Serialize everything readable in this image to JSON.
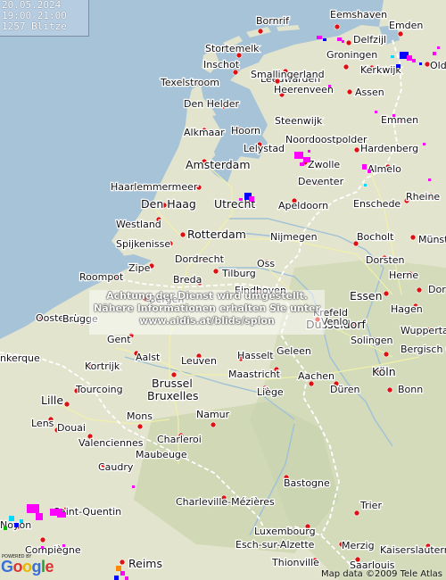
{
  "info": {
    "date": "20.05.2024",
    "time_range": "19:00-21:00",
    "strike_count": "1257 Blitze"
  },
  "notice": {
    "line1": "Achtung der Dienst wird umgestellt.",
    "line2": "Nähere Informationen erhalten Sie unter",
    "line3": "www.aldis.at/blids/splon"
  },
  "attribution": "Map data ©2009 Tele Atlas",
  "logo": {
    "powered": "POWERED BY",
    "g1": "G",
    "g2": "o",
    "g3": "o",
    "g4": "g",
    "g5": "l",
    "g6": "e"
  },
  "colors": {
    "sea": "#a7c3d8",
    "land": "#e6e2cf",
    "border": "#ffffff",
    "city": "#dd1111",
    "strike_recent": "#ff00ff",
    "strike_older": "#0000ff"
  },
  "cities": [
    {
      "name": "Bornrif"
    },
    {
      "name": "Eemshaven"
    },
    {
      "name": "Emden"
    },
    {
      "name": "Delfzijl"
    },
    {
      "name": "Stortemelk"
    },
    {
      "name": "Leeuwarden"
    },
    {
      "name": "Groningen"
    },
    {
      "name": "Kerkwijk"
    },
    {
      "name": "Olde"
    },
    {
      "name": "Inschot"
    },
    {
      "name": "Smallingerland"
    },
    {
      "name": "Texelstroom"
    },
    {
      "name": "Heerenveen"
    },
    {
      "name": "Assen"
    },
    {
      "name": "Den Helder"
    },
    {
      "name": "Steenwijk"
    },
    {
      "name": "Emmen"
    },
    {
      "name": "Alkmaar"
    },
    {
      "name": "Hoorn"
    },
    {
      "name": "Noordoostpolder"
    },
    {
      "name": "Lelystad"
    },
    {
      "name": "Hardenberg"
    },
    {
      "name": "Amsterdam"
    },
    {
      "name": "Zwolle"
    },
    {
      "name": "Almelo"
    },
    {
      "name": "Haarlemmermeer"
    },
    {
      "name": "Deventer"
    },
    {
      "name": "Den Haag"
    },
    {
      "name": "Utrecht"
    },
    {
      "name": "Apeldoorn"
    },
    {
      "name": "Enschede"
    },
    {
      "name": "Rheine"
    },
    {
      "name": "Westland"
    },
    {
      "name": "Rotterdam"
    },
    {
      "name": "Nijmegen"
    },
    {
      "name": "Bocholt"
    },
    {
      "name": "Münst"
    },
    {
      "name": "Spijkenisse"
    },
    {
      "name": "Dordrecht"
    },
    {
      "name": "Dorsten"
    },
    {
      "name": "Roompot"
    },
    {
      "name": "Zipe"
    },
    {
      "name": "Tilburg"
    },
    {
      "name": "Oss"
    },
    {
      "name": "Herne"
    },
    {
      "name": "Breda"
    },
    {
      "name": "Bergen"
    },
    {
      "name": "Eindhoven"
    },
    {
      "name": "Essen"
    },
    {
      "name": "Dor"
    },
    {
      "name": "Krefeld"
    },
    {
      "name": "Hagen"
    },
    {
      "name": "Oostende"
    },
    {
      "name": "Brugge"
    },
    {
      "name": "Gent"
    },
    {
      "name": "Düsseldorf"
    },
    {
      "name": "Wupperta"
    },
    {
      "name": "Venlo"
    },
    {
      "name": "Solingen"
    },
    {
      "name": "Bergisch Gladbach"
    },
    {
      "name": "nkerque"
    },
    {
      "name": "Aalst"
    },
    {
      "name": "Leuven"
    },
    {
      "name": "Hasselt"
    },
    {
      "name": "Geleen"
    },
    {
      "name": "Kortrijk"
    },
    {
      "name": "Köln"
    },
    {
      "name": "Lille"
    },
    {
      "name": "Tourcoing"
    },
    {
      "name": "Brussel"
    },
    {
      "name": "Bruxelles"
    },
    {
      "name": "Maastricht"
    },
    {
      "name": "Aachen"
    },
    {
      "name": "Düren"
    },
    {
      "name": "Bonn"
    },
    {
      "name": "Liège"
    },
    {
      "name": "Mons"
    },
    {
      "name": "Namur"
    },
    {
      "name": "Lens"
    },
    {
      "name": "Douai"
    },
    {
      "name": "Charleroi"
    },
    {
      "name": "Valenciennes"
    },
    {
      "name": "Maubeuge"
    },
    {
      "name": "Caudry"
    },
    {
      "name": "Bastogne"
    },
    {
      "name": "Charleville-Mézières"
    },
    {
      "name": "Saint-Quentin"
    },
    {
      "name": "Trier"
    },
    {
      "name": "Luxembourg"
    },
    {
      "name": "Esch-sur-Alzette"
    },
    {
      "name": "Compiègne"
    },
    {
      "name": "Merzig"
    },
    {
      "name": "Kaiserslautern"
    },
    {
      "name": "Reims"
    },
    {
      "name": "Thionville"
    },
    {
      "name": "Saarlouis"
    },
    {
      "name": "Noyon"
    }
  ],
  "strikes": [
    {
      "group": "friesland-east"
    },
    {
      "group": "emden-cluster"
    },
    {
      "group": "noordoostpolder"
    },
    {
      "group": "almelo"
    },
    {
      "group": "utrecht"
    },
    {
      "group": "saint-quentin"
    },
    {
      "group": "reims"
    }
  ]
}
